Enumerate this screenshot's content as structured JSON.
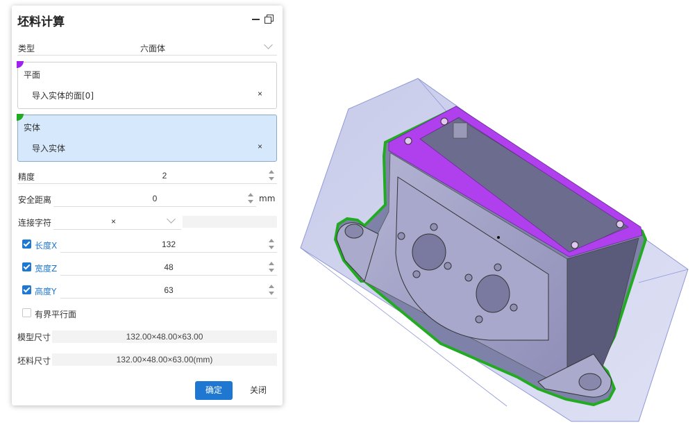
{
  "panel": {
    "title": "坯料计算",
    "type_label": "类型",
    "type_value": "六面体",
    "plane": {
      "label": "平面",
      "item": "导入实体的面[0]",
      "clear": "×",
      "marker_color": "#a020f0"
    },
    "solid": {
      "label": "实体",
      "item": "导入实体",
      "clear": "×",
      "marker_color": "#22aa22"
    },
    "precision": {
      "label": "精度",
      "value": "2"
    },
    "safe_distance": {
      "label": "安全距离",
      "value": "0",
      "unit": "mm"
    },
    "joiner": {
      "label": "连接字符",
      "value": "×"
    },
    "length": {
      "label": "长度X",
      "value": "132",
      "checked": true
    },
    "width": {
      "label": "宽度Z",
      "value": "48",
      "checked": true
    },
    "height": {
      "label": "高度Y",
      "value": "63",
      "checked": true
    },
    "bounded_plane": {
      "label": "有界平行面",
      "checked": false
    },
    "model_size": {
      "label": "模型尺寸",
      "value": "132.00×48.00×63.00"
    },
    "blank_size": {
      "label": "坯料尺寸",
      "value": "132.00×48.00×63.00(mm)"
    },
    "ok_label": "确定",
    "close_label": "关闭"
  },
  "viewport": {
    "selected_face_color": "#b040ee",
    "solid_outline_color": "#22aa22",
    "bounding_box_color": "#8f98d6"
  }
}
